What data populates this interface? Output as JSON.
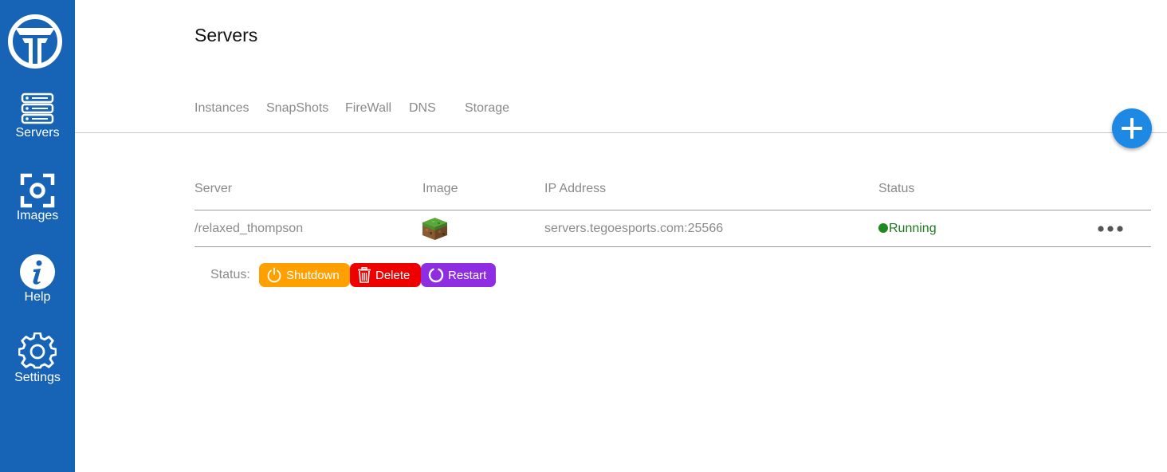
{
  "sidebar": {
    "logo_icon": "tegoesports-logo",
    "items": [
      {
        "label": "Servers",
        "icon": "server-stack-icon"
      },
      {
        "label": "Images",
        "icon": "focus-camera-icon"
      },
      {
        "label": "Help",
        "icon": "info-icon"
      },
      {
        "label": "Settings",
        "icon": "gear-icon"
      }
    ]
  },
  "page": {
    "title": "Servers"
  },
  "tabs": [
    "Instances",
    "SnapShots",
    "FireWall",
    "DNS",
    "Storage"
  ],
  "fab": {
    "icon": "plus-icon"
  },
  "table": {
    "columns": [
      "Server",
      "Image",
      "IP Address",
      "Status"
    ],
    "rows": [
      {
        "server": "/relaxed_thompson",
        "image_icon": "minecraft-grass-block-icon",
        "ip": "servers.tegoesports.com:25566",
        "status": "Running",
        "more_icon": "more-horizontal-icon"
      }
    ]
  },
  "actions": {
    "label": "Status:",
    "shutdown": "Shutdown",
    "delete": "Delete",
    "restart": "Restart"
  },
  "colors": {
    "sidebar": "#1763b6",
    "fab": "#1e88e5",
    "running": "#1f7a1f",
    "shutdown": "#ffa000",
    "delete": "#ee0000",
    "restart": "#8e2de2"
  }
}
